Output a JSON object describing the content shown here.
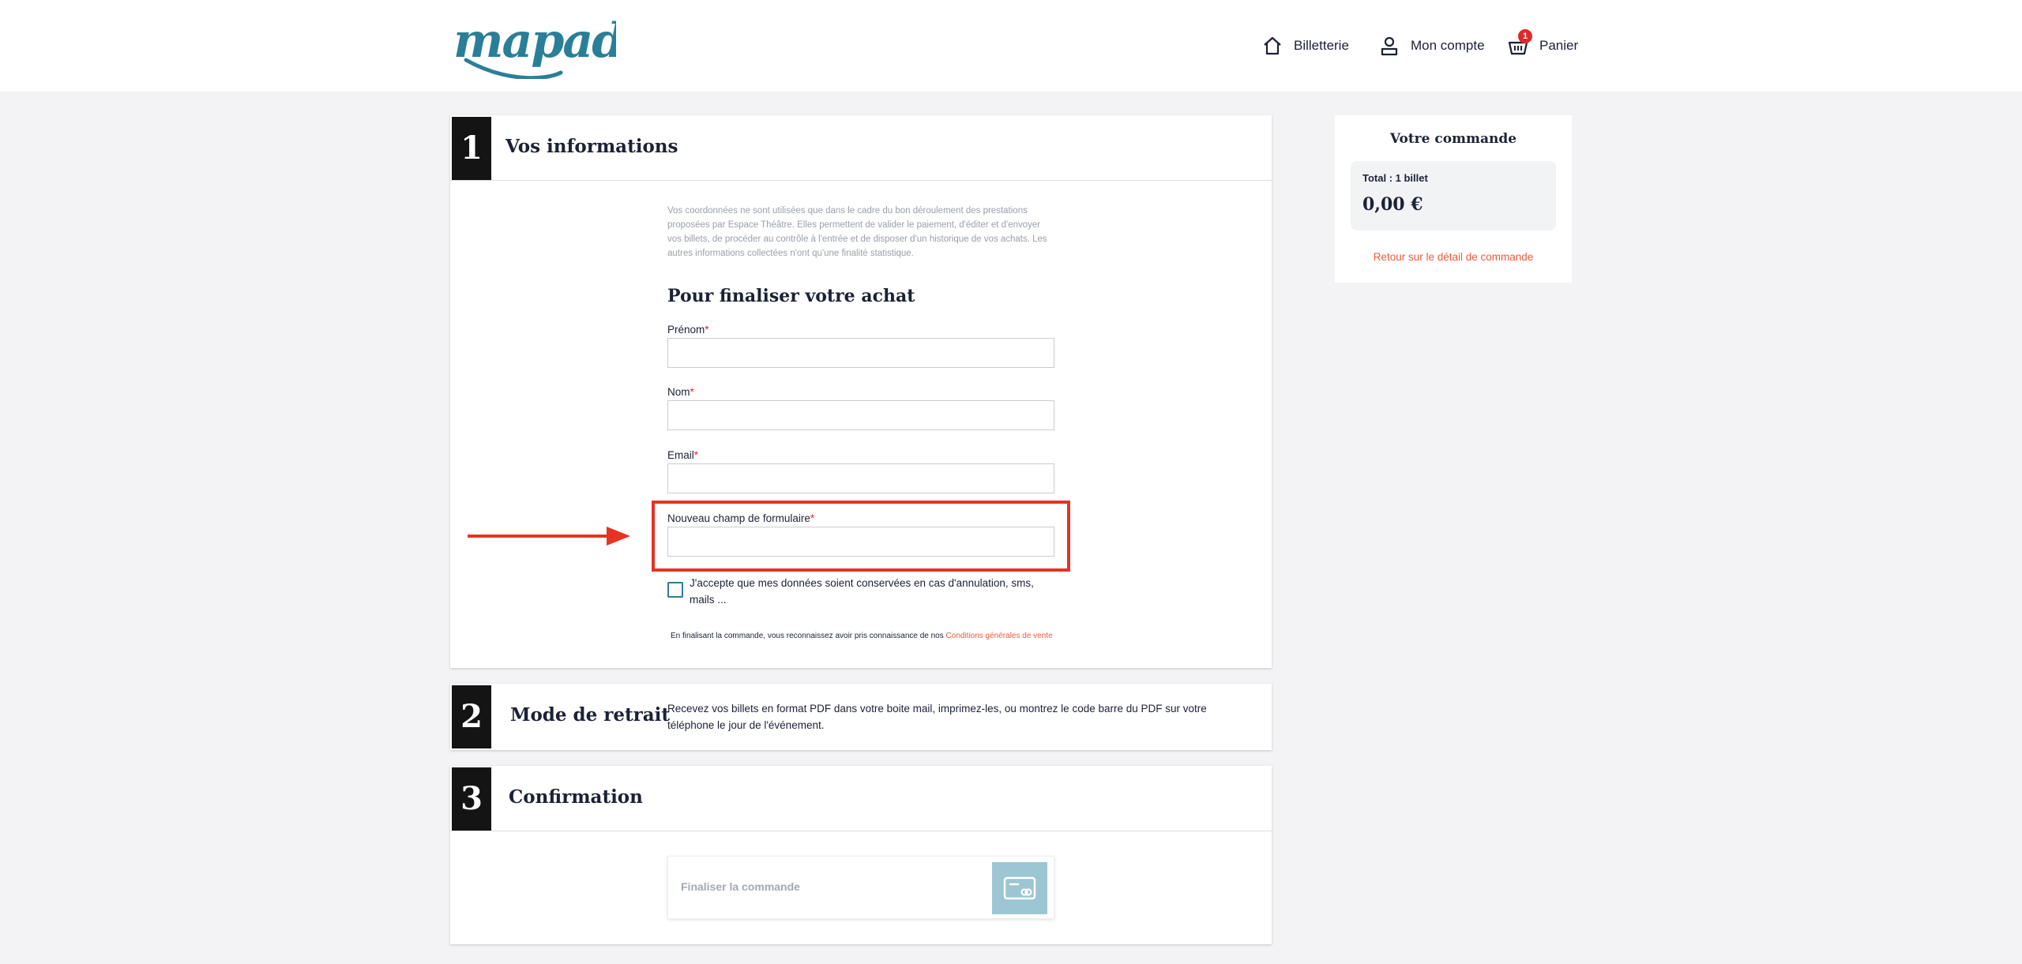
{
  "header": {
    "logo_text": "mapado",
    "nav": {
      "ticketing": "Billetterie",
      "account": "Mon compte",
      "cart": "Panier",
      "cart_count": "1"
    }
  },
  "step1": {
    "number": "1",
    "title": "Vos informations",
    "intro": "Vos coordonnées ne sont utilisées que dans le cadre du bon déroulement des prestations proposées par Espace Théâtre. Elles permettent de valider le paiement, d'éditer et d'envoyer vos billets, de procéder au contrôle à l'entrée et de disposer d'un historique de vos achats. Les autres informations collectées n'ont qu'une finalité statistique.",
    "form_heading": "Pour finaliser votre achat",
    "fields": [
      {
        "label": "Prénom",
        "required_mark": "*",
        "value": ""
      },
      {
        "label": "Nom",
        "required_mark": "*",
        "value": ""
      },
      {
        "label": "Email",
        "required_mark": "*",
        "value": ""
      },
      {
        "label": "Nouveau champ de formulaire",
        "required_mark": "*",
        "value": ""
      }
    ],
    "consent": "J'accepte que mes données soient conservées en cas d'annulation, sms, mails ...",
    "legal_prefix": "En finalisant la commande, vous reconnaissez avoir pris connaissance de nos",
    "legal_link": "Conditions générales de vente"
  },
  "step2": {
    "number": "2",
    "title": "Mode de retrait",
    "text": "Recevez vos billets en format PDF dans votre boite mail, imprimez-les, ou montrez le code barre du PDF sur votre téléphone le jour de l'événement."
  },
  "step3": {
    "number": "3",
    "title": "Confirmation",
    "button_label": "Finaliser la commande"
  },
  "summary": {
    "title": "Votre commande",
    "total_label": "Total : 1 billet",
    "price": "0,00 €",
    "back_link": "Retour sur le détail de commande"
  },
  "colors": {
    "brand": "#2a7f98",
    "accent_red": "#e63322",
    "link_orange": "#ef5a3c",
    "pay_button": "#9cc6d2"
  }
}
